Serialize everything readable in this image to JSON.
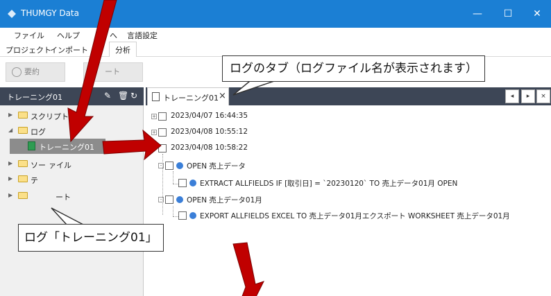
{
  "window": {
    "title": "THUMGY Data",
    "minimize_icon": "minimize-icon",
    "maximize_icon": "maximize-icon",
    "close_icon": "close-icon"
  },
  "menubar": {
    "items": [
      "ファイル",
      "ヘルプ",
      "へ",
      "言語設定"
    ]
  },
  "ribbon_tabs": {
    "items": [
      "プロジェクト",
      "インポート",
      "分析"
    ],
    "active": "分析"
  },
  "ribbon": {
    "summary_label": "要約",
    "partial_label": "ート"
  },
  "left_panel": {
    "header_title": "トレーニング01",
    "tree": [
      {
        "label": "スクリプト",
        "type": "folder",
        "expanded": false
      },
      {
        "label": "ログ",
        "type": "folder",
        "expanded": true
      },
      {
        "label": "トレーニング01",
        "type": "log",
        "selected": true
      },
      {
        "label": "ソー",
        "label_tail": "ァイル",
        "type": "folder",
        "expanded": false
      },
      {
        "label": "テ",
        "type": "folder",
        "expanded": false
      },
      {
        "label": "",
        "label_tail": "ート",
        "type": "folder",
        "expanded": false
      }
    ]
  },
  "doc_tab": {
    "label": "トレーニング01",
    "close": "×"
  },
  "nav_buttons": [
    "◂",
    "▸",
    "×"
  ],
  "log_entries": [
    {
      "text": "2023/04/07 16:44:35",
      "level": 0,
      "expander": "+"
    },
    {
      "text": "2023/04/08 10:55:12",
      "level": 0,
      "expander": "+"
    },
    {
      "text": "2023/04/08 10:58:22",
      "level": 0,
      "expander": "-"
    },
    {
      "text": "OPEN 売上データ",
      "level": 1,
      "expander": "-"
    },
    {
      "text": "EXTRACT ALLFIELDS IF [取引日] = `20230120` TO 売上データ01月 OPEN",
      "level": 2
    },
    {
      "text": "OPEN 売上データ01月",
      "level": 1,
      "expander": "-"
    },
    {
      "text": "EXPORT ALLFIELDS EXCEL TO 売上データ01月エクスポート WORKSHEET 売上データ01月",
      "level": 2
    }
  ],
  "annotations": {
    "tab_callout": "ログのタブ（ログファイル名が表示されます）",
    "log_callout": "ログ「トレーニング01」"
  },
  "colors": {
    "titlebar": "#1b7fd4",
    "panel_header": "#3d4656",
    "arrow": "#c00000",
    "node_dot": "#3b7fd8"
  }
}
